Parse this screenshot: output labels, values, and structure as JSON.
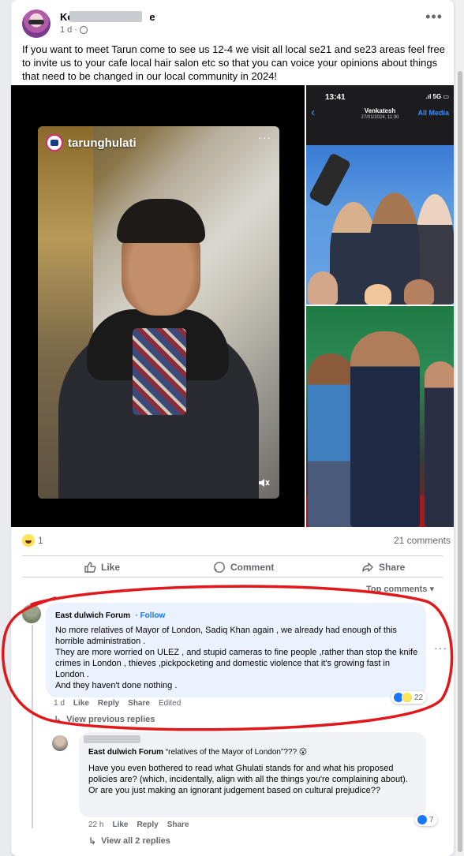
{
  "post": {
    "author_visible": "Ko",
    "author_tail": "e",
    "time": "1 d",
    "text": "If you want to meet Tarun come to see us 12-4 we visit all local se21 and se23 areas feel free to invite us to your cafe local hair salon etc so that you can voice your opinions about things that need to be changed in our local community in 2024!",
    "more_icon": "more-horizontal-icon"
  },
  "media": {
    "video_username": "tarunghulati",
    "phone_time": "13:41",
    "phone_signal": "5G",
    "phone_title": "Venkatesh",
    "phone_date": "27/01/2024, 11:30",
    "phone_all_media": "All Media"
  },
  "reactions": {
    "count": "1",
    "comments": "21 comments"
  },
  "actions": {
    "like": "Like",
    "comment": "Comment",
    "share": "Share",
    "top_comments": "Top comments ▾"
  },
  "comment1": {
    "author": "East dulwich Forum",
    "follow": "· Follow",
    "body": [
      "No more relatives of Mayor of London, Sadiq Khan again , we already had enough of this horrible administration .",
      "They are more worried on ULEZ , and stupid cameras to fine people ,rather than stop the knife crimes in London , thieves ,pickpocketing and domestic violence that it's growing fast in London .",
      "And they haven't done nothing ."
    ],
    "time": "1 d",
    "like": "Like",
    "reply": "Reply",
    "share": "Share",
    "edited": "Edited",
    "react_count": "22"
  },
  "view_previous": "View previous replies",
  "comment2": {
    "mention": "East dulwich Forum",
    "quote": "“relatives of the Mayor of London”??? 😮",
    "body": "Have you even bothered to read what Ghulati stands for and what his proposed policies are? (which, incidentally, align with all the things you're complaining about). Or are you just making an ignorant judgement based on cultural prejudice??",
    "time": "22 h",
    "like": "Like",
    "reply": "Reply",
    "share": "Share",
    "react_count": "7"
  },
  "view_all": "View all 2 replies",
  "colors": {
    "accent": "#1877f2",
    "annotation": "#e0181b",
    "muted": "#65676b"
  }
}
